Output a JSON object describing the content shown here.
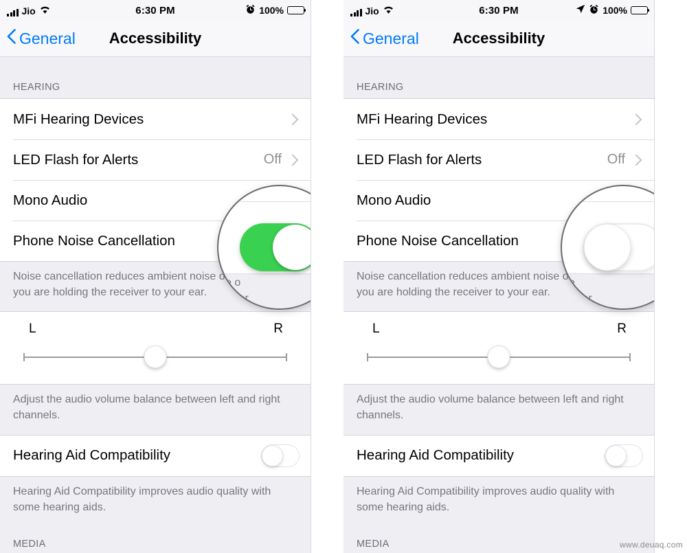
{
  "watermark": "www.deuaq.com",
  "panels": [
    {
      "id": "left",
      "status_bar": {
        "carrier": "Jio",
        "signal_icon": "signal-bars-icon",
        "wifi_icon": "wifi-icon",
        "time": "6:30 PM",
        "location_icon": null,
        "alarm_icon": "alarm-clock-icon",
        "battery_percent": "100%",
        "battery_icon": "battery-full-icon"
      },
      "nav": {
        "back_label": "General",
        "back_icon": "chevron-left-icon",
        "title": "Accessibility"
      },
      "section_header": "HEARING",
      "rows": [
        {
          "label": "MFi Hearing Devices",
          "value": "",
          "accessory": "chevron"
        },
        {
          "label": "LED Flash for Alerts",
          "value": "Off",
          "accessory": "chevron"
        },
        {
          "label": "Mono Audio",
          "value": "",
          "accessory": "switch-off"
        },
        {
          "label": "Phone Noise Cancellation",
          "value": "",
          "accessory": "switch-on"
        }
      ],
      "footnote_hearing": "Noise cancellation reduces ambient noise on calls when you are holding the receiver to your ear.",
      "balance": {
        "left_label": "L",
        "right_label": "R",
        "value_percent": 50
      },
      "footnote_balance": "Adjust the audio volume balance between left and right channels.",
      "hac_row": {
        "label": "Hearing Aid Compatibility",
        "accessory": "switch-off"
      },
      "footnote_hac": "Hearing Aid Compatibility improves audio quality with some hearing aids.",
      "next_section_header": "MEDIA",
      "magnifier": {
        "state": "on",
        "switch_color": "#3ad151",
        "footnote_line1": "se o",
        "footnote_line2": "ur ear."
      }
    },
    {
      "id": "right",
      "status_bar": {
        "carrier": "Jio",
        "signal_icon": "signal-bars-icon",
        "wifi_icon": "wifi-icon",
        "time": "6:30 PM",
        "location_icon": "location-arrow-icon",
        "alarm_icon": "alarm-clock-icon",
        "battery_percent": "100%",
        "battery_icon": "battery-full-icon"
      },
      "nav": {
        "back_label": "General",
        "back_icon": "chevron-left-icon",
        "title": "Accessibility"
      },
      "section_header": "HEARING",
      "rows": [
        {
          "label": "MFi Hearing Devices",
          "value": "",
          "accessory": "chevron"
        },
        {
          "label": "LED Flash for Alerts",
          "value": "Off",
          "accessory": "chevron"
        },
        {
          "label": "Mono Audio",
          "value": "",
          "accessory": "switch-off"
        },
        {
          "label": "Phone Noise Cancellation",
          "value": "",
          "accessory": "switch-off"
        }
      ],
      "footnote_hearing": "Noise cancellation reduces ambient noise on calls when you are holding the receiver to your ear.",
      "balance": {
        "left_label": "L",
        "right_label": "R",
        "value_percent": 50
      },
      "footnote_balance": "Adjust the audio volume balance between left and right channels.",
      "hac_row": {
        "label": "Hearing Aid Compatibility",
        "accessory": "switch-off"
      },
      "footnote_hac": "Hearing Aid Compatibility improves audio quality with some hearing aids.",
      "next_section_header": "MEDIA",
      "magnifier": {
        "state": "off",
        "switch_color": "#ffffff",
        "footnote_line1": "se",
        "footnote_line2": "ur ear."
      }
    }
  ]
}
